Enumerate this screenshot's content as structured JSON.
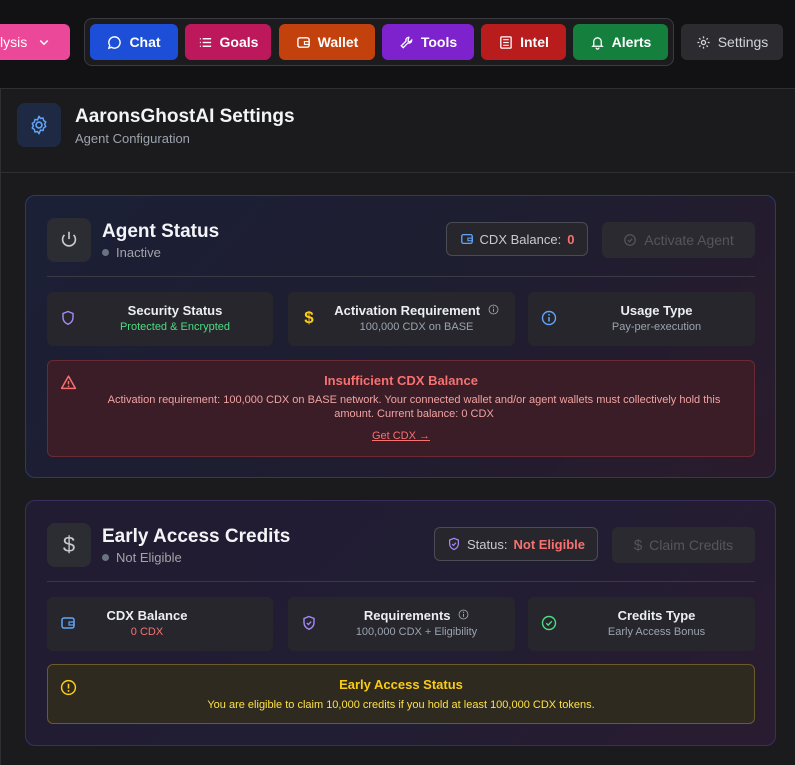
{
  "nav": {
    "analysis_label": "lysis",
    "chat_label": "Chat",
    "goals_label": "Goals",
    "wallet_label": "Wallet",
    "tools_label": "Tools",
    "intel_label": "Intel",
    "alerts_label": "Alerts",
    "settings_label": "Settings"
  },
  "header": {
    "title": "AaronsGhostAI Settings",
    "subtitle": "Agent Configuration"
  },
  "agent_status": {
    "title": "Agent Status",
    "status": "Inactive",
    "balance_label": "CDX Balance:",
    "balance_value": "0",
    "activate_label": "Activate Agent",
    "items": [
      {
        "title": "Security Status",
        "detail": "Protected & Encrypted",
        "icon": "shield-icon",
        "detail_color": "#4ade80"
      },
      {
        "title": "Activation Requirement",
        "detail": "100,000 CDX on BASE",
        "icon": "dollar-icon",
        "detail_color": "#9ca3af"
      },
      {
        "title": "Usage Type",
        "detail": "Pay-per-execution",
        "icon": "info-icon",
        "detail_color": "#9ca3af"
      }
    ],
    "alert": {
      "title": "Insufficient CDX Balance",
      "body": "Activation requirement: 100,000 CDX on BASE network. Your connected wallet and/or agent wallets must collectively hold this amount. Current balance: 0 CDX",
      "link": "Get CDX →"
    }
  },
  "early_access": {
    "title": "Early Access Credits",
    "status": "Not Eligible",
    "status_label": "Status:",
    "status_value": "Not Eligible",
    "claim_label": "Claim Credits",
    "items": [
      {
        "title": "CDX Balance",
        "detail": "0 CDX",
        "icon": "wallet-icon",
        "detail_color": "#f87171"
      },
      {
        "title": "Requirements",
        "detail": "100,000 CDX + Eligibility",
        "icon": "shield-icon",
        "detail_color": "#9ca3af"
      },
      {
        "title": "Credits Type",
        "detail": "Early Access Bonus",
        "icon": "check-circle-icon",
        "detail_color": "#9ca3af"
      }
    ],
    "alert": {
      "title": "Early Access Status",
      "body": "You are eligible to claim 10,000 credits if you hold at least 100,000 CDX tokens."
    }
  },
  "colors": {
    "chat": "#1d4ed8",
    "goals": "#be185d",
    "wallet": "#c2410c",
    "tools": "#7e22ce",
    "intel": "#b91c1c",
    "alerts": "#15803d",
    "analysis": "#ec4899",
    "settings": "#2c2c30"
  }
}
